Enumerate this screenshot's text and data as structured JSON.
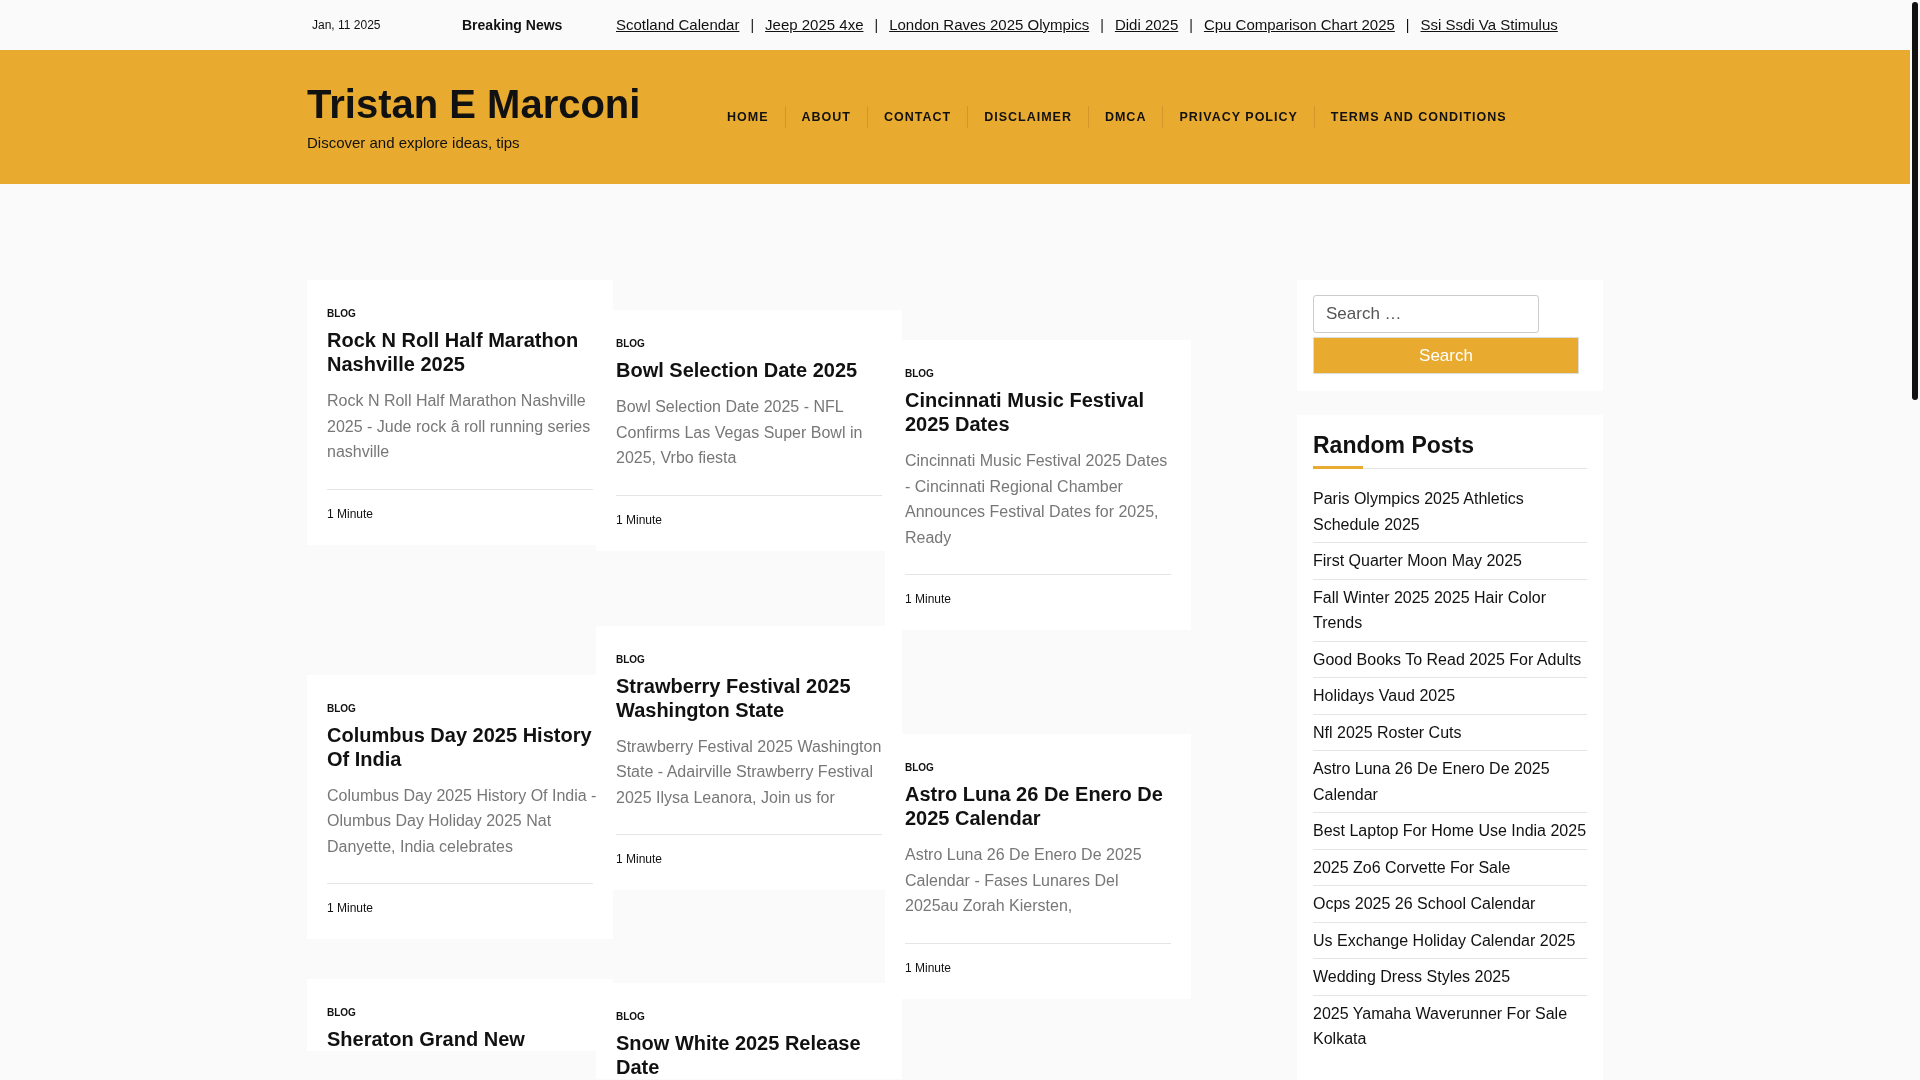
{
  "top_bar": {
    "date": "Jan, 11 2025",
    "breaking_label": "Breaking News",
    "separators": [
      "|",
      "|",
      "|",
      "|",
      "|"
    ],
    "links": [
      "Scotland Calendar",
      "Jeep 2025 4xe",
      "London Raves 2025 Olympics",
      "Didi 2025",
      "Cpu Comparison Chart 2025",
      "Ssi Ssdi Va Stimulus"
    ]
  },
  "header": {
    "site_title": "Tristan E Marconi",
    "tagline": "Discover and explore ideas, tips",
    "nav": [
      "HOME",
      "ABOUT",
      "CONTACT",
      "DISCLAIMER",
      "DMCA",
      "PRIVACY POLICY",
      "TERMS AND CONDITIONS"
    ]
  },
  "columns": [
    {
      "posts": [
        {
          "category": "BLOG",
          "title": "Rock N Roll Half Marathon Nashville 2025",
          "excerpt": "Rock N Roll Half Marathon Nashville 2025 - Jude rock â roll running series nashville",
          "read_time": "1 Minute"
        },
        {
          "category": "BLOG",
          "title": "Columbus Day 2025 History Of India",
          "excerpt": "Columbus Day 2025 History Of India - Olumbus Day Holiday 2025 Nat Danyette, India celebrates",
          "read_time": "1 Minute"
        },
        {
          "category": "BLOG",
          "title": "Sheraton Grand New"
        }
      ]
    },
    {
      "posts": [
        {
          "category": "BLOG",
          "title": "Bowl Selection Date 2025",
          "excerpt": "Bowl Selection Date 2025 - NFL Confirms Las Vegas Super Bowl in 2025, Vrbo fiesta",
          "read_time": "1 Minute"
        },
        {
          "category": "BLOG",
          "title": "Strawberry Festival 2025 Washington State",
          "excerpt": "Strawberry Festival 2025 Washington State - Adairville Strawberry Festival 2025 Ilysa Leanora, Join us for",
          "read_time": "1 Minute"
        },
        {
          "category": "BLOG",
          "title": "Snow White 2025 Release Date"
        }
      ]
    },
    {
      "posts": [
        {
          "category": "BLOG",
          "title": "Cincinnati Music Festival 2025 Dates",
          "excerpt": "Cincinnati Music Festival 2025 Dates - Cincinnati Regional Chamber Announces Festival Dates for 2025, Ready",
          "read_time": "1 Minute"
        },
        {
          "category": "BLOG",
          "title": "Astro Luna 26 De Enero De 2025 Calendar",
          "excerpt": "Astro Luna 26 De Enero De 2025 Calendar - Fases Lunares Del 2025au Zorah Kiersten,",
          "read_time": "1 Minute"
        }
      ]
    }
  ],
  "sidebar": {
    "search": {
      "placeholder": "Search …",
      "button": "Search"
    },
    "random_posts": {
      "title": "Random Posts",
      "items": [
        "Paris Olympics 2025 Athletics Schedule 2025",
        "First Quarter Moon May 2025",
        "Fall Winter 2025 2025 Hair Color Trends",
        "Good Books To Read 2025 For Adults",
        "Holidays Vaud 2025",
        "Nfl 2025 Roster Cuts",
        "Astro Luna 26 De Enero De 2025 Calendar",
        "Best Laptop For Home Use India 2025",
        "2025 Zo6 Corvette For Sale",
        "Ocps 2025 26 School Calendar",
        "Us Exchange Holiday Calendar 2025",
        "Wedding Dress Styles 2025",
        "2025 Yamaha Waverunner For Sale Kolkata"
      ]
    }
  }
}
